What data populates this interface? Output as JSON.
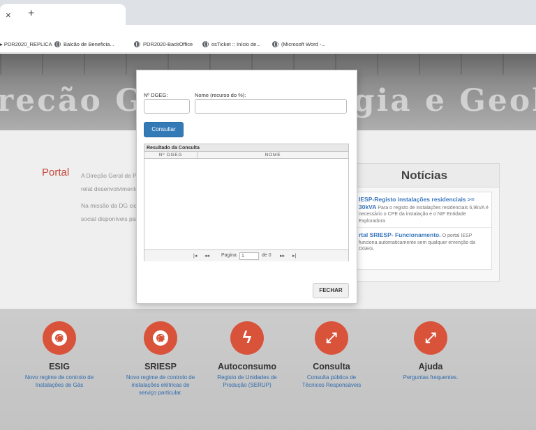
{
  "browser": {
    "tab_close": "×",
    "new_tab": "+",
    "bookmarks": [
      {
        "label": "PDR2020_REPLICA"
      },
      {
        "label": "Balcão de Beneficia..."
      },
      {
        "label": "PDR2020-BackOffice"
      },
      {
        "label": "osTicket :: Início de..."
      },
      {
        "label": "(Microsoft Word -..."
      }
    ]
  },
  "banner": {
    "title_left": "recão G",
    "title_right": "gia e Geolo"
  },
  "portal": {
    "title": "Portal",
    "p1": "A Direção Geral de Portuguesa que ter das políticas relat desenvolvimento su",
    "p2": "Na missão da DG cidadãos para a i económico e social disponíveis para a e acompanhamento e"
  },
  "news": {
    "title": "Notícias",
    "items": [
      {
        "headline": "IESP-Registo instalações residenciais >= 30kVA",
        "body": "Para o registo de instalações residenciais 6,9kVA é necessário o CPE da instalação e o NIF Entidade Exploradora"
      },
      {
        "headline": "rtal SRIESP- Funcionamento.",
        "body": "O portal IESP funciona automaticamente sem qualquer ervenção da DGEG."
      }
    ]
  },
  "services": [
    {
      "title": "ESIG",
      "sub": "Novo regime de controlo de Instalações de Gás",
      "icon": "lifebuoy-icon"
    },
    {
      "title": "SRIESP",
      "sub": "Novo regime de controlo de instalações elétricas de serviço particular.",
      "icon": "lifebuoy-icon"
    },
    {
      "title": "Autoconsumo",
      "sub": "Registo de Unidades de Produção (SERUP)",
      "icon": "lightning-icon"
    },
    {
      "title": "Consulta",
      "sub": "Consulta pública de Técnicos Responsáveis",
      "icon": "expand-icon"
    },
    {
      "title": "Ajuda",
      "sub": "Perguntas frequentes.",
      "icon": "expand-icon"
    }
  ],
  "modal": {
    "dgeg_label": "Nº DGEG:",
    "nome_label": "Nome (recurso do %):",
    "dgeg_value": "",
    "nome_value": "",
    "consultar_label": "Consultar",
    "grid_caption": "Resultado da Consulta",
    "col_dgeg": "Nº DGEG",
    "col_nome": "NOME",
    "pager": {
      "first": "|◂",
      "prev": "◂◂",
      "page_label": "Pagina",
      "page_value": "1",
      "of_label": "de 0",
      "next": "▸▸",
      "last": "▸|"
    },
    "fechar_label": "FECHAR"
  },
  "colors": {
    "accent_red": "#d6452b",
    "link_blue": "#1e5fa6",
    "primary_button": "#337ab7"
  }
}
